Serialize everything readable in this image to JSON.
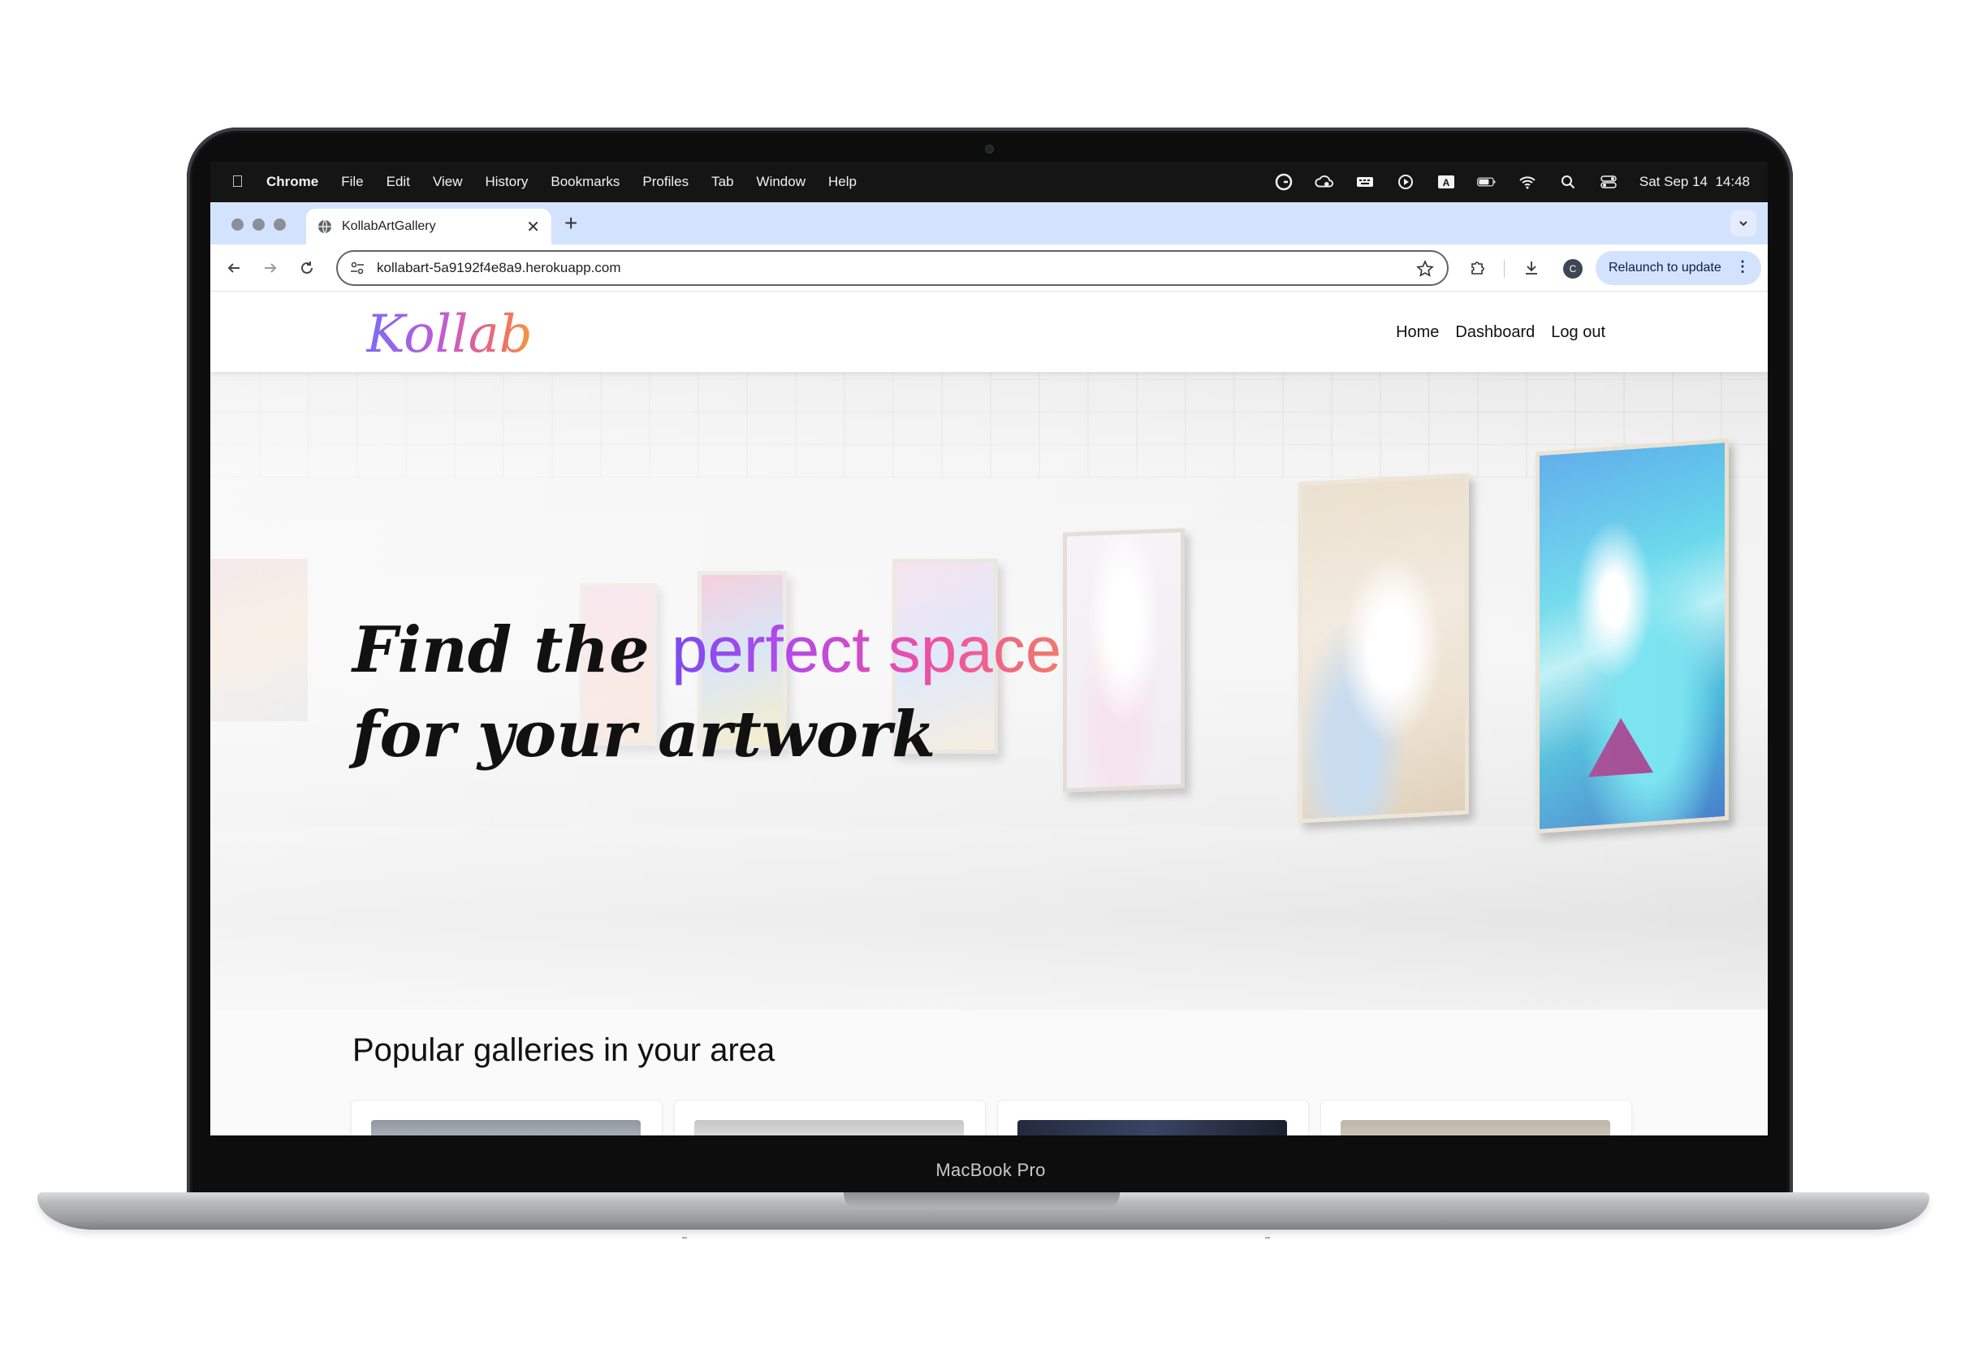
{
  "device": {
    "label": "MacBook Pro"
  },
  "menubar": {
    "app_name": "Chrome",
    "items": [
      "File",
      "Edit",
      "View",
      "History",
      "Bookmarks",
      "Profiles",
      "Tab",
      "Window",
      "Help"
    ],
    "clock": "Sat Sep 14  14:48",
    "status_icons": [
      "grammarly-icon",
      "cloud-sync-icon",
      "keyboard-icon",
      "play-icon",
      "input-source-icon",
      "battery-icon",
      "wifi-icon",
      "spotlight-search-icon",
      "control-center-icon"
    ],
    "input_source_letter": "A"
  },
  "browser": {
    "tab_title": "KollabArtGallery",
    "url": "kollabart-5a9192f4e8a9.herokuapp.com",
    "profile_initial": "C",
    "relaunch_label": "Relaunch to update"
  },
  "site": {
    "logo": "Kollab",
    "nav": [
      "Home",
      "Dashboard",
      "Log out"
    ],
    "hero": {
      "line1_plain": "Find the ",
      "line1_highlight": "perfect space",
      "line2": "for your artwork"
    },
    "popular_title": "Popular galleries in your area"
  },
  "colors": {
    "tabstrip_bg": "#d3e3fd",
    "relaunch_bg": "#d3e3fd",
    "logo_gradient": [
      "#7b6cf6",
      "#c05ad6",
      "#f06a6a",
      "#f59a3d"
    ],
    "headline_gradient": [
      "#7b4bf0",
      "#b44ae8",
      "#ec4fa7",
      "#f07a6a"
    ]
  }
}
